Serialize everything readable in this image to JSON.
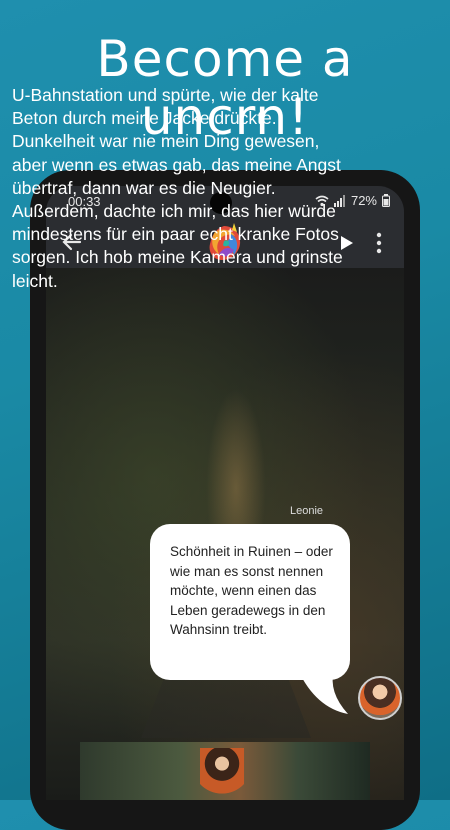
{
  "headline": {
    "line1": "Become a",
    "line2": "uncrn!"
  },
  "statusbar": {
    "time": "00:33",
    "battery": "72%"
  },
  "story": {
    "text": "U-Bahnstation und spürte, wie der kalte Beton durch meine Jacke drückte. Dunkelheit war nie mein Ding gewesen, aber wenn es etwas gab, das meine Angst übertraf, dann war es die Neugier. Außerdem, dachte ich mir, das hier würde mindestens für ein paar echt kranke Fotos sorgen. Ich hob meine Kamera und grinste leicht."
  },
  "dialogue": {
    "speaker": "Leonie",
    "text": "Schönheit in Ruinen – oder wie man es sonst nennen möchte, wenn einen das Leben geradewegs in den Wahnsinn treibt."
  },
  "icons": {
    "back": "arrow-back-icon",
    "logo": "unicorn-logo-icon",
    "play": "play-icon",
    "more": "more-vertical-icon",
    "wifi": "wifi-icon",
    "signal": "signal-icon",
    "battery": "battery-icon"
  },
  "colors": {
    "background": "#1a8aa5",
    "bar": "#2b2d31",
    "bubble": "#ffffff"
  }
}
